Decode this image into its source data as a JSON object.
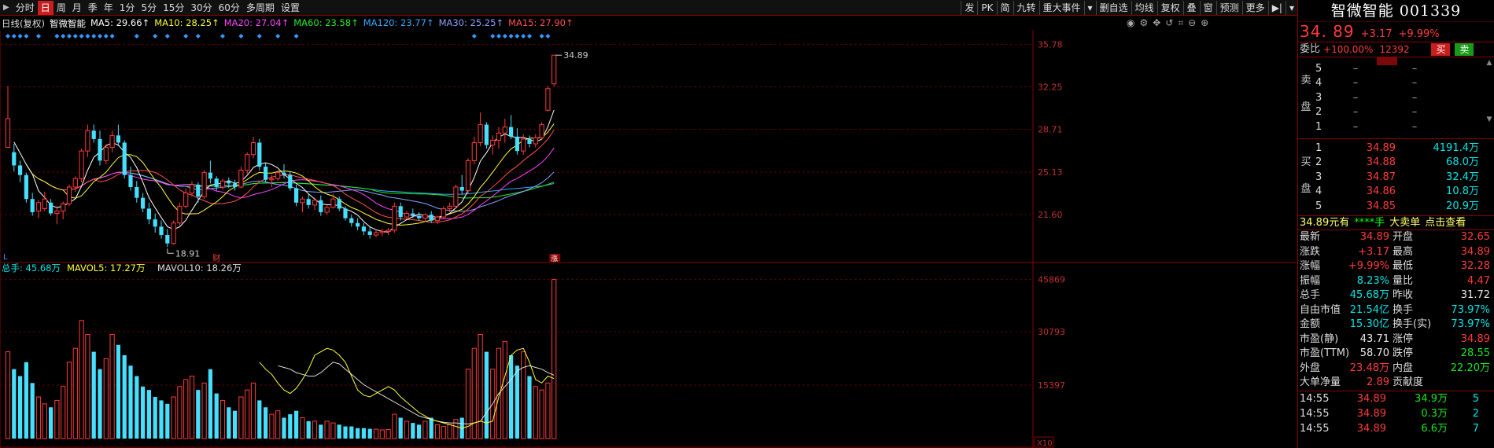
{
  "toolbar": {
    "tabs": [
      "分时",
      "日",
      "周",
      "月",
      "季",
      "年",
      "1分",
      "5分",
      "15分",
      "30分",
      "60分",
      "多周期",
      "设置"
    ],
    "active_tab": "日",
    "tools": [
      "发",
      "PK",
      "简",
      "九转",
      "重大事件",
      "▾",
      "删自选",
      "均线",
      "复权",
      "叠",
      "窗",
      "预测",
      "更多",
      "▶|",
      "▾"
    ]
  },
  "legend": {
    "title": "日线(复权)",
    "stock": "智微智能",
    "ma5": "MA5: 29.66↑",
    "ma10": "MA10: 28.25↑",
    "ma20": "MA20: 27.04↑",
    "ma60": "MA60: 23.58↑",
    "ma120": "MA120: 23.77↑",
    "ma30": "MA30: 25.25↑",
    "ma15": "MA15: 27.90↑"
  },
  "colors": {
    "up": "#ff3b3b",
    "down": "#45e0ff",
    "ma5": "#ffffff",
    "ma10": "#ffff33",
    "ma20": "#ff44ff",
    "ma30": "#8aa0ff",
    "ma60": "#22ee22",
    "ma120": "#33aaff",
    "ma15": "#ff5050"
  },
  "chart_data": [
    {
      "type": "candlestick",
      "title": "日线(复权)",
      "y_ticks": [
        "35.78",
        "32.25",
        "28.71",
        "25.13",
        "21.60"
      ],
      "ylim": [
        18.0,
        37.0
      ],
      "annotations": {
        "high": "34.89",
        "low": "18.91",
        "event_mark": "财",
        "limit_up_mark": "涨",
        "corner_mark": "L"
      },
      "candles": [
        [
          27.2,
          32.3,
          27.2,
          29.6
        ],
        [
          26.8,
          27.5,
          25.2,
          25.7
        ],
        [
          25.7,
          26.1,
          24.3,
          24.9
        ],
        [
          24.9,
          25.1,
          22.6,
          22.9
        ],
        [
          22.9,
          23.4,
          21.5,
          21.8
        ],
        [
          21.9,
          22.8,
          21.3,
          22.6
        ],
        [
          22.1,
          23.5,
          21.9,
          22.9
        ],
        [
          22.6,
          22.9,
          21.5,
          21.7
        ],
        [
          21.7,
          22.3,
          20.8,
          21.9
        ],
        [
          21.9,
          22.7,
          21.2,
          22.5
        ],
        [
          22.5,
          24.1,
          22.3,
          23.9
        ],
        [
          23.9,
          24.8,
          23.5,
          24.6
        ],
        [
          24.6,
          27.1,
          24.3,
          26.9
        ],
        [
          26.9,
          29.1,
          26.4,
          28.6
        ],
        [
          28.6,
          29.1,
          27.6,
          27.9
        ],
        [
          27.9,
          28.6,
          25.7,
          26.1
        ],
        [
          26.1,
          27.5,
          25.8,
          27.2
        ],
        [
          27.2,
          28.6,
          26.8,
          28.2
        ],
        [
          28.2,
          29.1,
          27.3,
          27.6
        ],
        [
          27.6,
          27.8,
          24.6,
          24.9
        ],
        [
          24.9,
          25.6,
          23.6,
          23.9
        ],
        [
          23.9,
          24.4,
          22.6,
          23.0
        ],
        [
          23.0,
          23.4,
          21.8,
          22.1
        ],
        [
          22.1,
          22.6,
          20.8,
          21.2
        ],
        [
          21.2,
          21.7,
          20.1,
          20.6
        ],
        [
          20.6,
          21.1,
          19.6,
          19.9
        ],
        [
          19.9,
          20.4,
          18.9,
          19.2
        ],
        [
          19.2,
          21.1,
          19.1,
          20.9
        ],
        [
          20.9,
          22.6,
          20.7,
          22.3
        ],
        [
          22.3,
          23.8,
          22.1,
          23.4
        ],
        [
          23.4,
          24.4,
          23.1,
          24.1
        ],
        [
          24.1,
          24.3,
          22.6,
          23.1
        ],
        [
          23.1,
          25.3,
          22.9,
          25.1
        ],
        [
          25.1,
          26.1,
          24.2,
          24.6
        ],
        [
          24.6,
          24.8,
          23.6,
          23.9
        ],
        [
          23.9,
          24.6,
          23.7,
          24.4
        ],
        [
          24.4,
          24.7,
          23.8,
          24.2
        ],
        [
          24.2,
          24.5,
          23.6,
          23.9
        ],
        [
          23.9,
          25.6,
          23.8,
          25.3
        ],
        [
          25.3,
          26.8,
          25.0,
          26.6
        ],
        [
          26.6,
          28.1,
          26.3,
          27.6
        ],
        [
          27.6,
          27.9,
          25.3,
          25.6
        ],
        [
          25.6,
          25.9,
          24.3,
          24.5
        ],
        [
          24.5,
          24.9,
          23.9,
          24.6
        ],
        [
          24.6,
          25.3,
          24.4,
          25.1
        ],
        [
          25.1,
          25.8,
          24.6,
          24.9
        ],
        [
          24.9,
          25.2,
          23.6,
          23.8
        ],
        [
          23.8,
          24.1,
          22.3,
          22.6
        ],
        [
          22.6,
          23.1,
          21.8,
          22.9
        ],
        [
          22.9,
          23.3,
          22.1,
          22.4
        ],
        [
          22.4,
          23.0,
          22.0,
          22.8
        ],
        [
          22.8,
          23.2,
          21.5,
          21.8
        ],
        [
          21.8,
          22.4,
          21.6,
          22.2
        ],
        [
          22.2,
          23.3,
          22.1,
          22.9
        ],
        [
          22.9,
          23.1,
          21.9,
          22.1
        ],
        [
          22.1,
          22.3,
          21.1,
          21.3
        ],
        [
          21.3,
          21.6,
          20.6,
          20.9
        ],
        [
          20.9,
          21.3,
          20.3,
          20.6
        ],
        [
          20.6,
          20.9,
          19.9,
          20.2
        ],
        [
          20.2,
          20.6,
          19.6,
          19.9
        ],
        [
          19.9,
          20.3,
          19.7,
          20.1
        ],
        [
          20.1,
          20.4,
          19.8,
          20.2
        ],
        [
          20.2,
          20.5,
          19.9,
          20.3
        ],
        [
          20.3,
          22.6,
          20.1,
          22.3
        ],
        [
          22.3,
          22.6,
          21.1,
          21.4
        ],
        [
          21.4,
          21.9,
          21.2,
          21.7
        ],
        [
          21.7,
          22.1,
          21.3,
          21.5
        ],
        [
          21.5,
          21.8,
          21.1,
          21.3
        ],
        [
          21.3,
          21.7,
          21.0,
          21.6
        ],
        [
          21.6,
          21.9,
          20.9,
          21.1
        ],
        [
          21.1,
          21.5,
          20.8,
          21.4
        ],
        [
          21.4,
          22.3,
          21.3,
          22.1
        ],
        [
          22.1,
          22.6,
          21.8,
          22.3
        ],
        [
          22.3,
          24.1,
          22.1,
          23.9
        ],
        [
          23.9,
          24.9,
          23.3,
          23.6
        ],
        [
          23.6,
          26.3,
          23.4,
          26.1
        ],
        [
          26.1,
          28.1,
          25.8,
          27.6
        ],
        [
          27.6,
          30.1,
          27.3,
          29.1
        ],
        [
          29.1,
          29.3,
          27.1,
          27.4
        ],
        [
          27.4,
          28.2,
          26.6,
          27.8
        ],
        [
          27.8,
          28.9,
          27.1,
          28.4
        ],
        [
          28.4,
          29.6,
          27.6,
          28.9
        ],
        [
          28.9,
          29.9,
          27.9,
          28.1
        ],
        [
          28.1,
          28.8,
          26.6,
          26.9
        ],
        [
          26.9,
          28.3,
          26.6,
          27.9
        ],
        [
          27.9,
          28.2,
          27.2,
          27.5
        ],
        [
          27.5,
          28.3,
          27.2,
          28.0
        ],
        [
          28.0,
          29.3,
          27.8,
          29.1
        ],
        [
          30.3,
          32.3,
          30.2,
          32.1
        ],
        [
          32.5,
          34.89,
          32.28,
          34.89
        ]
      ]
    },
    {
      "type": "bar",
      "title": "总手",
      "legend": {
        "vol": "总手: 45.68万",
        "mavol5": "MAVOL5: 17.27万",
        "mavol10": "MAVOL10: 18.26万"
      },
      "y_ticks": [
        "45869",
        "30793",
        "15397"
      ],
      "corner_mark": "X10",
      "ylim": [
        0,
        48000
      ],
      "values": [
        25000,
        20000,
        18000,
        22000,
        16000,
        12000,
        10000,
        9000,
        11000,
        15000,
        22000,
        26000,
        34000,
        30000,
        25000,
        20000,
        23000,
        30000,
        27000,
        24000,
        21000,
        18000,
        15000,
        14000,
        12000,
        11000,
        10000,
        12000,
        15000,
        17000,
        18000,
        14000,
        16000,
        20000,
        13000,
        11000,
        9000,
        8000,
        12000,
        14000,
        16000,
        11000,
        9000,
        7000,
        8000,
        6000,
        7000,
        8000,
        6000,
        5000,
        5000,
        4000,
        5000,
        4500,
        4000,
        3500,
        3500,
        3000,
        3000,
        2800,
        2700,
        2500,
        2600,
        7000,
        6000,
        5000,
        4500,
        4000,
        5000,
        6000,
        4000,
        3500,
        4000,
        5500,
        6000,
        20000,
        26000,
        30000,
        25000,
        20000,
        26000,
        28000,
        24000,
        21000,
        25000,
        18000,
        15000,
        14000,
        16000,
        45869
      ],
      "mavol5": [
        22000,
        20000,
        18500,
        16000,
        14000,
        13000,
        14500,
        17000,
        20000,
        24000,
        25000,
        26000,
        25500,
        24000,
        22000,
        18000,
        14000,
        12500,
        12000,
        13000,
        14000,
        15000,
        14000,
        12000,
        10500,
        9000,
        7500,
        6500,
        5500,
        5000,
        4500,
        4000,
        3500,
        3000,
        3500,
        4500,
        5000,
        4500,
        5000,
        12000,
        18000,
        24000,
        25500,
        26000,
        22000,
        17000,
        16000,
        18000,
        17270
      ],
      "mavol10": [
        21000,
        20500,
        20000,
        19000,
        18500,
        18000,
        18000,
        19000,
        20500,
        22000,
        21500,
        20000,
        18500,
        17000,
        15500,
        14500,
        13500,
        12500,
        11500,
        10500,
        9500,
        8500,
        7500,
        6500,
        6000,
        5500,
        5000,
        4700,
        4500,
        4500,
        4300,
        4200,
        4500,
        5000,
        7500,
        10000,
        13000,
        15000,
        17000,
        19500,
        20500,
        21000,
        20500,
        20000,
        19000,
        18260
      ]
    }
  ],
  "panel": {
    "title": "智微智能 001339",
    "price": "34. 89",
    "change": "+3.17",
    "change_pct": "+9.99%",
    "weibi_label": "委比",
    "weibi_pct": "+100.00%",
    "weibi_vol": "12392",
    "buy_btn": "买",
    "sell_btn": "卖",
    "sell_side": [
      "卖",
      "盘"
    ],
    "buy_side": [
      "买",
      "盘"
    ],
    "asks": [
      {
        "lv": "5",
        "p": "–",
        "v": "–"
      },
      {
        "lv": "4",
        "p": "–",
        "v": "–"
      },
      {
        "lv": "3",
        "p": "–",
        "v": "–"
      },
      {
        "lv": "2",
        "p": "–",
        "v": "–"
      },
      {
        "lv": "1",
        "p": "–",
        "v": "–"
      }
    ],
    "bids": [
      {
        "lv": "1",
        "p": "34.89",
        "v": "4191.4万"
      },
      {
        "lv": "2",
        "p": "34.88",
        "v": "68.0万"
      },
      {
        "lv": "3",
        "p": "34.87",
        "v": "32.4万"
      },
      {
        "lv": "4",
        "p": "34.86",
        "v": "10.8万"
      },
      {
        "lv": "5",
        "p": "34.85",
        "v": "20.9万"
      }
    ],
    "bigorder": {
      "a": "34.89元有",
      "b": "****手",
      "c": "大卖单",
      "d": "点击查看"
    },
    "stats": [
      {
        "k": "最新",
        "v": "34.89",
        "vc": "red",
        "k2": "开盘",
        "v2": "32.65",
        "v2c": "red"
      },
      {
        "k": "涨跌",
        "v": "+3.17",
        "vc": "red",
        "k2": "最高",
        "v2": "34.89",
        "v2c": "red"
      },
      {
        "k": "涨幅",
        "v": "+9.99%",
        "vc": "red",
        "k2": "最低",
        "v2": "32.28",
        "v2c": "red"
      },
      {
        "k": "振幅",
        "v": "8.23%",
        "vc": "cyan",
        "k2": "量比",
        "v2": "4.47",
        "v2c": "red"
      },
      {
        "k": "总手",
        "v": "45.68万",
        "vc": "cyan",
        "k2": "昨收",
        "v2": "31.72",
        "v2c": "white"
      },
      {
        "k": "自由市值",
        "v": "21.54亿",
        "vc": "cyan",
        "k2": "换手",
        "v2": "73.97%",
        "v2c": "cyan"
      },
      {
        "k": "金额",
        "v": "15.30亿",
        "vc": "cyan",
        "k2": "换手(实)",
        "v2": "73.97%",
        "v2c": "cyan"
      },
      {
        "k": "市盈(静)",
        "v": "43.71",
        "vc": "white",
        "k2": "涨停",
        "v2": "34.89",
        "v2c": "red"
      },
      {
        "k": "市盈(TTM)",
        "v": "58.70",
        "vc": "white",
        "k2": "跌停",
        "v2": "28.55",
        "v2c": "green"
      },
      {
        "k": "外盘",
        "v": "23.48万",
        "vc": "red",
        "k2": "内盘",
        "v2": "22.20万",
        "v2c": "green"
      },
      {
        "k": "大单净量",
        "v": "2.89",
        "vc": "red",
        "k2": "贡献度",
        "v2": "",
        "v2c": "white"
      }
    ],
    "ticks": [
      {
        "t": "14:55",
        "p": "34.89",
        "q": "34.9万",
        "n": "5"
      },
      {
        "t": "14:55",
        "p": "34.89",
        "q": "0.3万",
        "n": "2"
      },
      {
        "t": "14:55",
        "p": "34.89",
        "q": "6.6万",
        "n": "7"
      }
    ]
  }
}
